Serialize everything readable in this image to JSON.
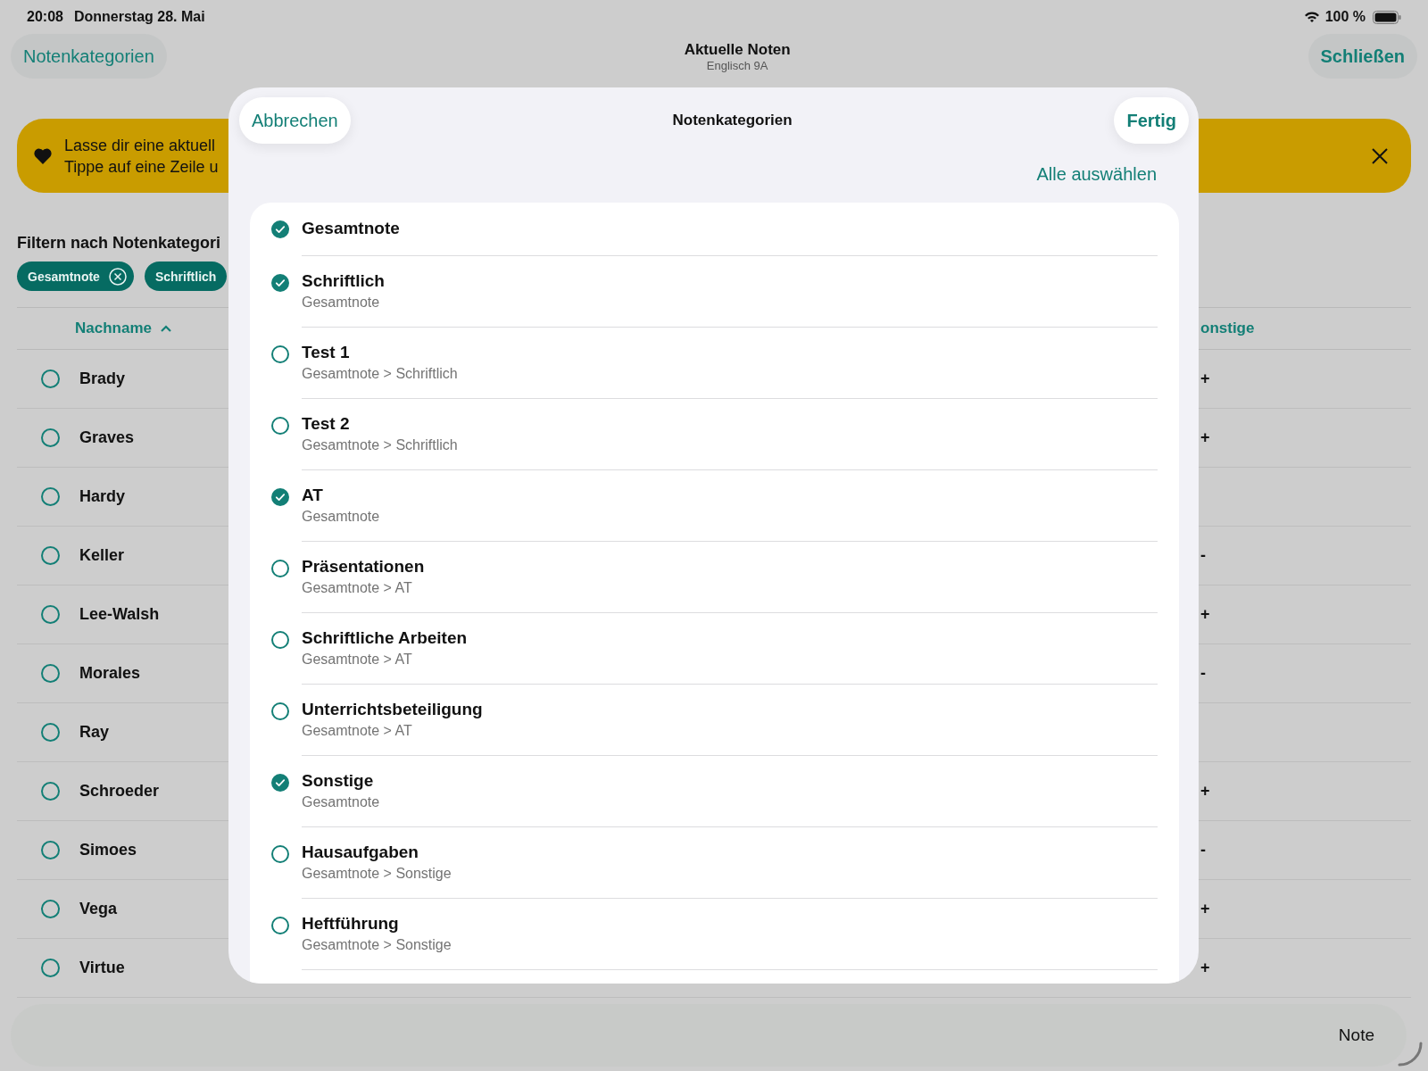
{
  "status_bar": {
    "time": "20:08",
    "date": "Donnerstag 28. Mai",
    "battery": "100 %"
  },
  "nav": {
    "left_button": "Notenkategorien",
    "title": "Aktuelle Noten",
    "subtitle": "Englisch 9A",
    "right_button": "Schließen"
  },
  "banner": {
    "lines": [
      "Lasse dir eine aktuell",
      "Tippe auf eine Zeile u"
    ]
  },
  "filter": {
    "label": "Filtern nach Notenkategori",
    "chips": [
      {
        "label": "Gesamtnote",
        "removable": true
      },
      {
        "label": "Schriftlich",
        "removable": false
      }
    ]
  },
  "table": {
    "columns": [
      "Nachname",
      "onstige"
    ],
    "rows": [
      {
        "name": "Brady",
        "selected": false,
        "column_2": "+"
      },
      {
        "name": "Graves",
        "selected": false,
        "column_2": "+"
      },
      {
        "name": "Hardy",
        "selected": false
      },
      {
        "name": "Keller",
        "selected": false,
        "column_2": "-"
      },
      {
        "name": "Lee-Walsh",
        "selected": false,
        "column_2": "+"
      },
      {
        "name": "Morales",
        "selected": false,
        "column_2": "-"
      },
      {
        "name": "Ray",
        "selected": false
      },
      {
        "name": "Schroeder",
        "selected": false,
        "column_2": "+"
      },
      {
        "name": "Simoes",
        "selected": false,
        "column_2": "-"
      },
      {
        "name": "Vega",
        "selected": false,
        "column_2": "+"
      },
      {
        "name": "Virtue",
        "selected": false,
        "column_2": "+"
      }
    ]
  },
  "toolbar": {
    "button": "Note"
  },
  "sheet": {
    "cancel": "Abbrechen",
    "title": "Notenkategorien",
    "done": "Fertig",
    "select_all": "Alle auswählen",
    "categories": [
      {
        "name": "Gesamtnote",
        "checked": true
      },
      {
        "name": "Schriftlich",
        "path": "Gesamtnote",
        "checked": true
      },
      {
        "name": "Test 1",
        "path": "Gesamtnote > Schriftlich",
        "checked": false
      },
      {
        "name": "Test 2",
        "path": "Gesamtnote > Schriftlich",
        "checked": false
      },
      {
        "name": "AT",
        "path": "Gesamtnote",
        "checked": true
      },
      {
        "name": "Präsentationen",
        "path": "Gesamtnote > AT",
        "checked": false
      },
      {
        "name": "Schriftliche Arbeiten",
        "path": "Gesamtnote > AT",
        "checked": false
      },
      {
        "name": "Unterrichtsbeteiligung",
        "path": "Gesamtnote > AT",
        "checked": false
      },
      {
        "name": "Sonstige",
        "path": "Gesamtnote",
        "checked": true
      },
      {
        "name": "Hausaufgaben",
        "path": "Gesamtnote > Sonstige",
        "checked": false
      },
      {
        "name": "Heftführung",
        "path": "Gesamtnote > Sonstige",
        "checked": false
      }
    ]
  }
}
